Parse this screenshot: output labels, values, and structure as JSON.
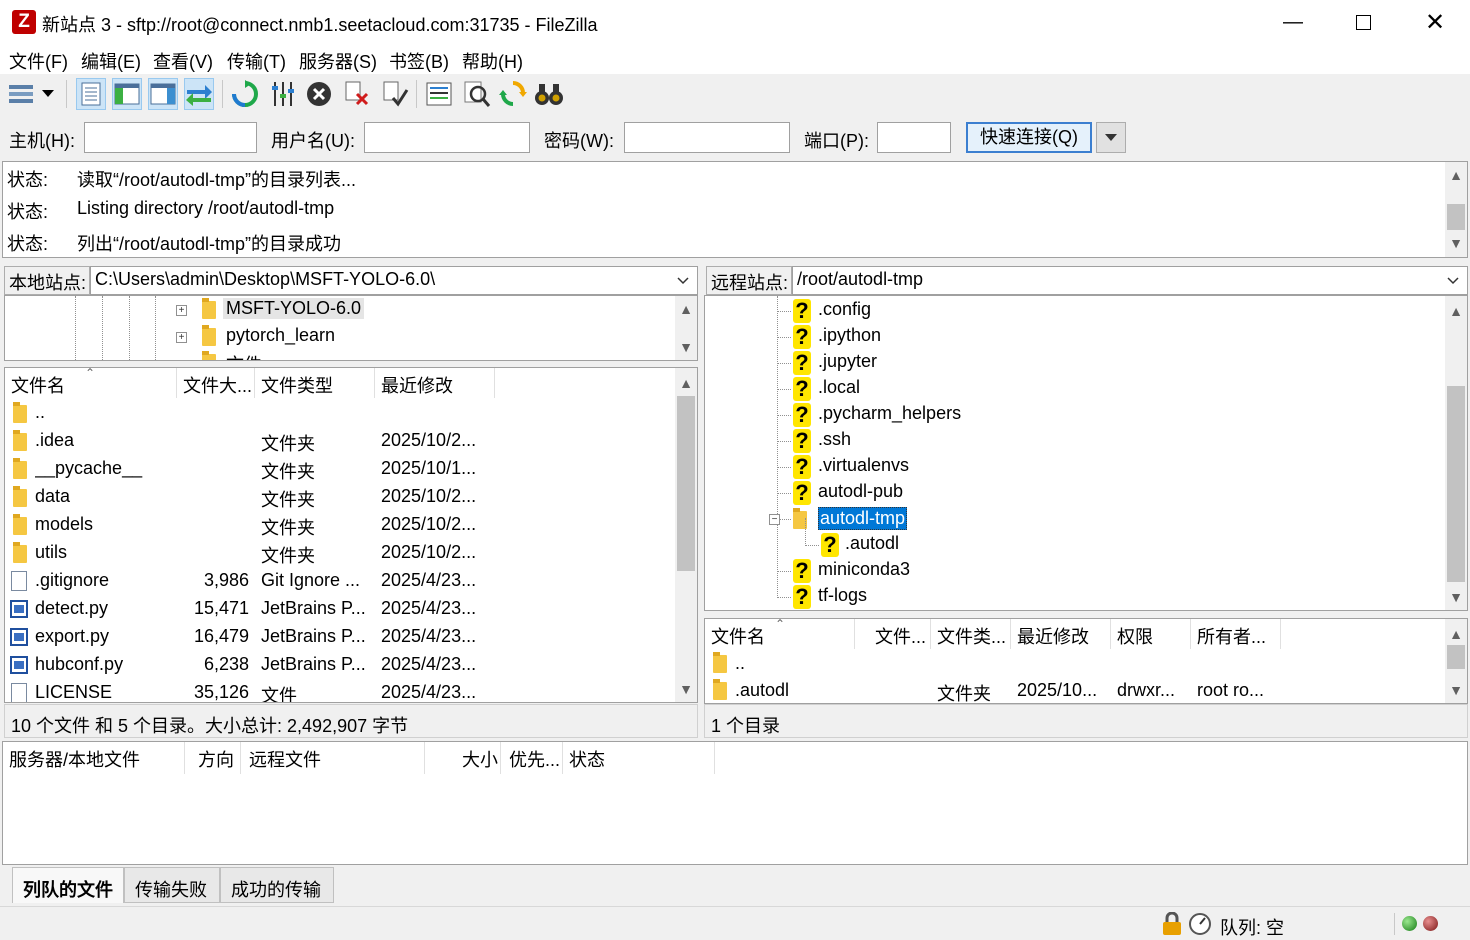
{
  "window": {
    "title": "新站点 3 - sftp://root@connect.nmb1.seetacloud.com:31735 - FileZilla",
    "app_icon": "Z"
  },
  "menu": [
    "文件(F)",
    "编辑(E)",
    "查看(V)",
    "传输(T)",
    "服务器(S)",
    "书签(B)",
    "帮助(H)"
  ],
  "quickconnect": {
    "host_label": "主机(H):",
    "user_label": "用户名(U):",
    "pass_label": "密码(W):",
    "port_label": "端口(P):",
    "host_value": "",
    "user_value": "",
    "pass_value": "",
    "port_value": "",
    "button": "快速连接(Q)"
  },
  "log": [
    {
      "label": "状态:",
      "text": "读取“/root/autodl-tmp”的目录列表..."
    },
    {
      "label": "状态:",
      "text": "Listing directory /root/autodl-tmp"
    },
    {
      "label": "状态:",
      "text": "列出“/root/autodl-tmp”的目录成功"
    }
  ],
  "local": {
    "site_label": "本地站点:",
    "path": "C:\\Users\\admin\\Desktop\\MSFT-YOLO-6.0\\",
    "tree": [
      {
        "name": "MSFT-YOLO-6.0",
        "selected": true
      },
      {
        "name": "pytorch_learn",
        "selected": false
      },
      {
        "name": "文件",
        "selected": false
      }
    ],
    "columns": [
      "文件名",
      "文件大...",
      "文件类型",
      "最近修改"
    ],
    "files": [
      {
        "name": "..",
        "size": "",
        "type": "",
        "modified": "",
        "icon": "folder"
      },
      {
        "name": ".idea",
        "size": "",
        "type": "文件夹",
        "modified": "2025/10/2...",
        "icon": "folder"
      },
      {
        "name": "__pycache__",
        "size": "",
        "type": "文件夹",
        "modified": "2025/10/1...",
        "icon": "folder"
      },
      {
        "name": "data",
        "size": "",
        "type": "文件夹",
        "modified": "2025/10/2...",
        "icon": "folder"
      },
      {
        "name": "models",
        "size": "",
        "type": "文件夹",
        "modified": "2025/10/2...",
        "icon": "folder"
      },
      {
        "name": "utils",
        "size": "",
        "type": "文件夹",
        "modified": "2025/10/2...",
        "icon": "folder"
      },
      {
        "name": ".gitignore",
        "size": "3,986",
        "type": "Git Ignore ...",
        "modified": "2025/4/23...",
        "icon": "file"
      },
      {
        "name": "detect.py",
        "size": "15,471",
        "type": "JetBrains P...",
        "modified": "2025/4/23...",
        "icon": "py"
      },
      {
        "name": "export.py",
        "size": "16,479",
        "type": "JetBrains P...",
        "modified": "2025/4/23...",
        "icon": "py"
      },
      {
        "name": "hubconf.py",
        "size": "6,238",
        "type": "JetBrains P...",
        "modified": "2025/4/23...",
        "icon": "py"
      },
      {
        "name": "LICENSE",
        "size": "35,126",
        "type": "文件",
        "modified": "2025/4/23...",
        "icon": "file"
      }
    ],
    "status": "10 个文件 和 5 个目录。大小总计: 2,492,907 字节"
  },
  "remote": {
    "site_label": "远程站点:",
    "path": "/root/autodl-tmp",
    "tree": [
      {
        "name": ".config",
        "icon": "unknown",
        "selected": false
      },
      {
        "name": ".ipython",
        "icon": "unknown",
        "selected": false
      },
      {
        "name": ".jupyter",
        "icon": "unknown",
        "selected": false
      },
      {
        "name": ".local",
        "icon": "unknown",
        "selected": false
      },
      {
        "name": ".pycharm_helpers",
        "icon": "unknown",
        "selected": false
      },
      {
        "name": ".ssh",
        "icon": "unknown",
        "selected": false
      },
      {
        "name": ".virtualenvs",
        "icon": "unknown",
        "selected": false
      },
      {
        "name": "autodl-pub",
        "icon": "unknown",
        "selected": false
      },
      {
        "name": "autodl-tmp",
        "icon": "folder",
        "selected": true
      },
      {
        "name": ".autodl",
        "icon": "unknown",
        "selected": false
      },
      {
        "name": "miniconda3",
        "icon": "unknown",
        "selected": false
      },
      {
        "name": "tf-logs",
        "icon": "unknown",
        "selected": false
      }
    ],
    "columns": [
      "文件名",
      "文件...",
      "文件类...",
      "最近修改",
      "权限",
      "所有者..."
    ],
    "files": [
      {
        "name": "..",
        "size": "",
        "type": "",
        "modified": "",
        "perm": "",
        "owner": ""
      },
      {
        "name": ".autodl",
        "size": "",
        "type": "文件夹",
        "modified": "2025/10...",
        "perm": "drwxr...",
        "owner": "root ro..."
      }
    ],
    "status": "1 个目录"
  },
  "queue": {
    "columns": [
      "服务器/本地文件",
      "方向",
      "远程文件",
      "大小",
      "优先...",
      "状态"
    ],
    "tabs": [
      "列队的文件",
      "传输失败",
      "成功的传输"
    ],
    "status_text": "队列: 空"
  },
  "colors": {
    "selection": "#0078d7",
    "accent_border": "#3c7fd0"
  }
}
